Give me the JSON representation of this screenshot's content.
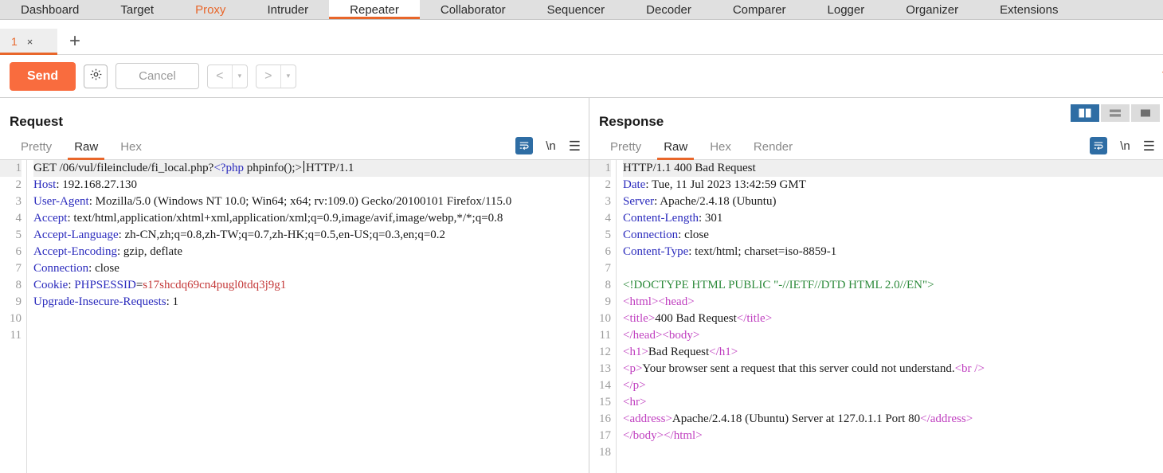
{
  "suite_tabs": [
    {
      "label": "Dashboard",
      "state": "normal"
    },
    {
      "label": "Target",
      "state": "normal"
    },
    {
      "label": "Proxy",
      "state": "accent"
    },
    {
      "label": "Intruder",
      "state": "normal"
    },
    {
      "label": "Repeater",
      "state": "active"
    },
    {
      "label": "Collaborator",
      "state": "normal"
    },
    {
      "label": "Sequencer",
      "state": "normal"
    },
    {
      "label": "Decoder",
      "state": "normal"
    },
    {
      "label": "Comparer",
      "state": "normal"
    },
    {
      "label": "Logger",
      "state": "normal"
    },
    {
      "label": "Organizer",
      "state": "normal"
    },
    {
      "label": "Extensions",
      "state": "normal"
    }
  ],
  "repeater_tabs": {
    "tabs": [
      {
        "label": "1",
        "close": "×"
      }
    ],
    "add_label": "+"
  },
  "toolbar": {
    "send_label": "Send",
    "settings_icon": "gear-icon",
    "cancel_label": "Cancel",
    "back_label": "<",
    "forward_label": ">",
    "caret": "▾",
    "target_label": "T"
  },
  "layout_buttons": [
    {
      "name": "side-by-side",
      "active": true
    },
    {
      "name": "stacked",
      "active": false
    },
    {
      "name": "single",
      "active": false
    }
  ],
  "request": {
    "title": "Request",
    "tabs": [
      {
        "label": "Pretty",
        "active": false
      },
      {
        "label": "Raw",
        "active": true
      },
      {
        "label": "Hex",
        "active": false
      }
    ],
    "tools": {
      "wrap": "word-wrap-icon",
      "newline": "\\n",
      "menu": "☰"
    },
    "line_count": 11,
    "lines": [
      {
        "n": 1,
        "highlight": true,
        "parts": [
          {
            "t": "GET /06/vul/fileinclude/fi_local.php?",
            "c": "val"
          },
          {
            "t": "<?php",
            "c": "kw"
          },
          {
            "t": " phpinfo();>",
            "c": "val"
          },
          {
            "t": "CARET",
            "c": "caret"
          },
          {
            "t": "HTTP/1.1",
            "c": "val"
          }
        ]
      },
      {
        "n": 2,
        "highlight": false,
        "parts": [
          {
            "t": "Host",
            "c": "hdr"
          },
          {
            "t": ": 192.168.27.130",
            "c": "val"
          }
        ]
      },
      {
        "n": 3,
        "highlight": false,
        "parts": [
          {
            "t": "User-Agent",
            "c": "hdr"
          },
          {
            "t": ": Mozilla/5.0 (Windows NT 10.0; Win64; x64; rv:109.0) Gecko/20100101 Firefox/115.0",
            "c": "val"
          }
        ]
      },
      {
        "n": 4,
        "highlight": false,
        "parts": [
          {
            "t": "Accept",
            "c": "hdr"
          },
          {
            "t": ": text/html,application/xhtml+xml,application/xml;q=0.9,image/avif,image/webp,*/*;q=0.8",
            "c": "val"
          }
        ]
      },
      {
        "n": 5,
        "highlight": false,
        "parts": [
          {
            "t": "Accept-Language",
            "c": "hdr"
          },
          {
            "t": ": zh-CN,zh;q=0.8,zh-TW;q=0.7,zh-HK;q=0.5,en-US;q=0.3,en;q=0.2",
            "c": "val"
          }
        ]
      },
      {
        "n": 6,
        "highlight": false,
        "parts": [
          {
            "t": "Accept-Encoding",
            "c": "hdr"
          },
          {
            "t": ": gzip, deflate",
            "c": "val"
          }
        ]
      },
      {
        "n": 7,
        "highlight": false,
        "parts": [
          {
            "t": "Connection",
            "c": "hdr"
          },
          {
            "t": ": close",
            "c": "val"
          }
        ]
      },
      {
        "n": 8,
        "highlight": false,
        "parts": [
          {
            "t": "Cookie",
            "c": "hdr"
          },
          {
            "t": ": ",
            "c": "val"
          },
          {
            "t": "PHPSESSID",
            "c": "kw"
          },
          {
            "t": "=",
            "c": "val"
          },
          {
            "t": "s17shcdq69cn4pugl0tdq3j9g1",
            "c": "red"
          }
        ]
      },
      {
        "n": 9,
        "highlight": false,
        "parts": [
          {
            "t": "Upgrade-Insecure-Requests",
            "c": "hdr"
          },
          {
            "t": ": 1",
            "c": "val"
          }
        ]
      },
      {
        "n": 10,
        "highlight": false,
        "parts": []
      },
      {
        "n": 11,
        "highlight": false,
        "parts": []
      }
    ]
  },
  "response": {
    "title": "Response",
    "tabs": [
      {
        "label": "Pretty",
        "active": false
      },
      {
        "label": "Raw",
        "active": true
      },
      {
        "label": "Hex",
        "active": false
      },
      {
        "label": "Render",
        "active": false
      }
    ],
    "tools": {
      "wrap": "word-wrap-icon",
      "newline": "\\n",
      "menu": "☰"
    },
    "line_count": 18,
    "lines": [
      {
        "n": 1,
        "highlight": true,
        "parts": [
          {
            "t": "HTTP/1.1 400 Bad Request",
            "c": "val"
          }
        ]
      },
      {
        "n": 2,
        "highlight": false,
        "parts": [
          {
            "t": "Date",
            "c": "hdr"
          },
          {
            "t": ": Tue, 11 Jul 2023 13:42:59 GMT",
            "c": "val"
          }
        ]
      },
      {
        "n": 3,
        "highlight": false,
        "parts": [
          {
            "t": "Server",
            "c": "hdr"
          },
          {
            "t": ": Apache/2.4.18 (Ubuntu)",
            "c": "val"
          }
        ]
      },
      {
        "n": 4,
        "highlight": false,
        "parts": [
          {
            "t": "Content-Length",
            "c": "hdr"
          },
          {
            "t": ": 301",
            "c": "val"
          }
        ]
      },
      {
        "n": 5,
        "highlight": false,
        "parts": [
          {
            "t": "Connection",
            "c": "hdr"
          },
          {
            "t": ": close",
            "c": "val"
          }
        ]
      },
      {
        "n": 6,
        "highlight": false,
        "parts": [
          {
            "t": "Content-Type",
            "c": "hdr"
          },
          {
            "t": ": text/html; charset=iso-8859-1",
            "c": "val"
          }
        ]
      },
      {
        "n": 7,
        "highlight": false,
        "parts": []
      },
      {
        "n": 8,
        "highlight": false,
        "parts": [
          {
            "t": "<!DOCTYPE HTML PUBLIC \"-//IETF//DTD HTML 2.0//EN\">",
            "c": "doct"
          }
        ]
      },
      {
        "n": 9,
        "highlight": false,
        "parts": [
          {
            "t": "<html><head>",
            "c": "tag"
          }
        ]
      },
      {
        "n": 10,
        "highlight": false,
        "parts": [
          {
            "t": "<title>",
            "c": "tag"
          },
          {
            "t": "400 Bad Request",
            "c": "val"
          },
          {
            "t": "</title>",
            "c": "tag"
          }
        ]
      },
      {
        "n": 11,
        "highlight": false,
        "parts": [
          {
            "t": "</head><body>",
            "c": "tag"
          }
        ]
      },
      {
        "n": 12,
        "highlight": false,
        "parts": [
          {
            "t": "<h1>",
            "c": "tag"
          },
          {
            "t": "Bad Request",
            "c": "val"
          },
          {
            "t": "</h1>",
            "c": "tag"
          }
        ]
      },
      {
        "n": 13,
        "highlight": false,
        "parts": [
          {
            "t": "<p>",
            "c": "tag"
          },
          {
            "t": "Your browser sent a request that this server could not understand.",
            "c": "val"
          },
          {
            "t": "<br />",
            "c": "tag"
          }
        ]
      },
      {
        "n": 14,
        "highlight": false,
        "parts": [
          {
            "t": "</p>",
            "c": "tag"
          }
        ]
      },
      {
        "n": 15,
        "highlight": false,
        "parts": [
          {
            "t": "<hr>",
            "c": "tag"
          }
        ]
      },
      {
        "n": 16,
        "highlight": false,
        "parts": [
          {
            "t": "<address>",
            "c": "tag"
          },
          {
            "t": "Apache/2.4.18 (Ubuntu) Server at 127.0.1.1 Port 80",
            "c": "val"
          },
          {
            "t": "</address>",
            "c": "tag"
          }
        ]
      },
      {
        "n": 17,
        "highlight": false,
        "parts": [
          {
            "t": "</body></html>",
            "c": "tag"
          }
        ]
      },
      {
        "n": 18,
        "highlight": false,
        "parts": []
      }
    ]
  }
}
